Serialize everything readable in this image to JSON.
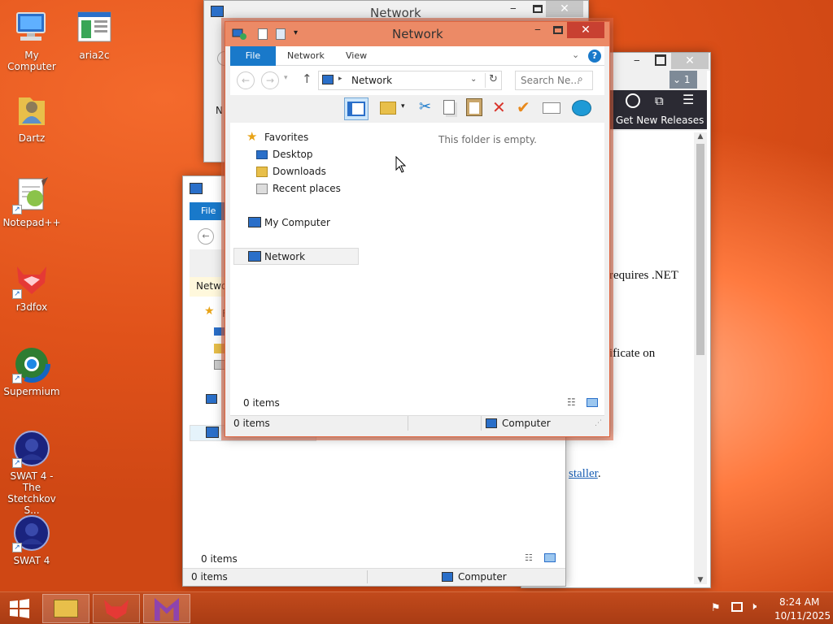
{
  "desktop": {
    "icons": [
      {
        "label": "My Computer"
      },
      {
        "label": "aria2c"
      },
      {
        "label": "Dartz"
      },
      {
        "label": "Notepad++"
      },
      {
        "label": "r3dfox"
      },
      {
        "label": "Supermium"
      },
      {
        "label": "SWAT 4 - The Stetchkov S..."
      },
      {
        "label": "SWAT 4"
      }
    ]
  },
  "back_window": {
    "title": "Network",
    "tab_fragment": "N"
  },
  "browser_window": {
    "tab_count": "1",
    "get_new_releases": "Get New Releases",
    "text1": "requires .NET",
    "text2": "ificate on",
    "link": "staller",
    "link_tail": "."
  },
  "mid_window": {
    "tab_file": "File",
    "addr_fragment": "Netwo",
    "fav_fragment": "F",
    "status_items": "0 items",
    "status_items2": "0 items",
    "status_computer": "Computer"
  },
  "front_window": {
    "title": "Network",
    "tabs": {
      "file": "File",
      "network": "Network",
      "view": "View"
    },
    "address": "Network",
    "search_placeholder": "Search Ne...",
    "empty_message": "This folder is empty.",
    "tree": {
      "favorites": "Favorites",
      "desktop": "Desktop",
      "downloads": "Downloads",
      "recent": "Recent places",
      "computer": "My Computer",
      "network": "Network"
    },
    "content_status": "0 items",
    "status_items": "0 items",
    "status_computer": "Computer"
  },
  "tray": {
    "time": "8:24 AM",
    "date": "10/11/2025"
  }
}
